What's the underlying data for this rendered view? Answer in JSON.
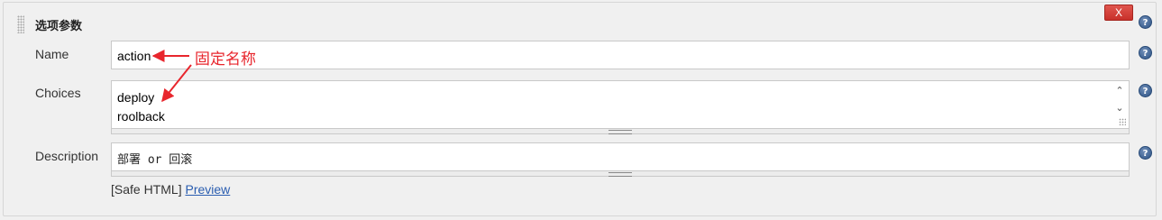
{
  "section": {
    "title": "选项参数",
    "delete_label": "X"
  },
  "name": {
    "label": "Name",
    "value": "action"
  },
  "choices": {
    "label": "Choices",
    "lines": [
      "deploy",
      "roolback"
    ]
  },
  "description": {
    "label": "Description",
    "value": "部署 or 回滚"
  },
  "safe_html": {
    "prefix": "[Safe HTML]",
    "preview_label": "Preview"
  },
  "annotation": {
    "text": "固定名称",
    "color": "#e8262d"
  },
  "icons": {
    "help": "help-icon",
    "scroll_up": "chevron-up-icon",
    "scroll_down": "chevron-down-icon"
  }
}
